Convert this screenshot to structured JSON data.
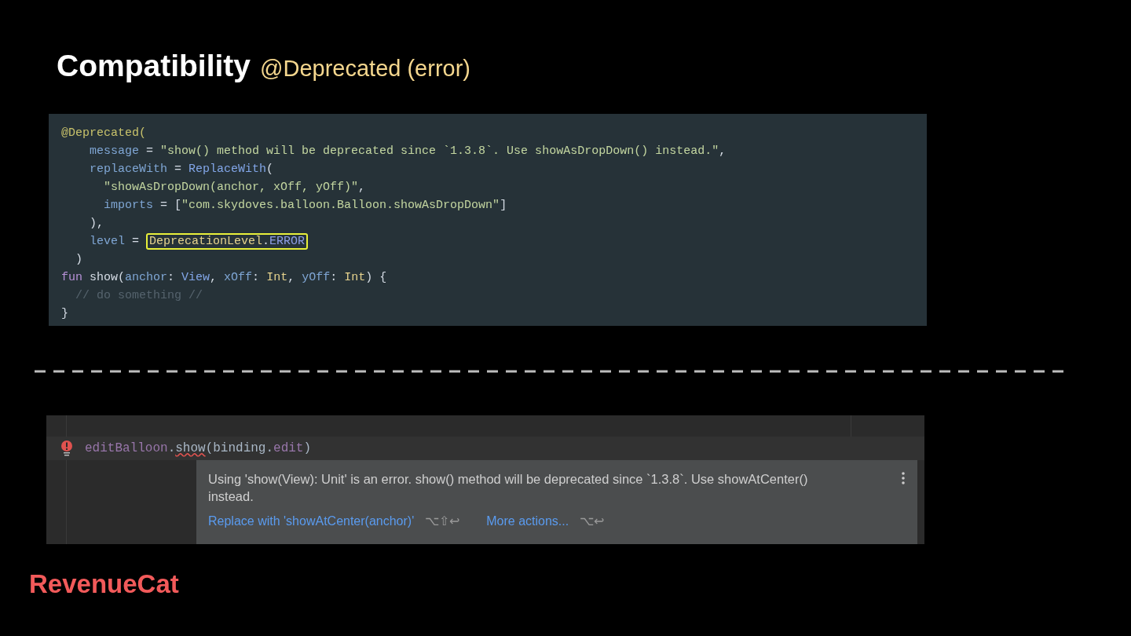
{
  "title": {
    "main": "Compatibility",
    "subtitle": "@Deprecated (error)"
  },
  "declaration_code": [
    [
      {
        "kind": "annotation",
        "text": "@Deprecated("
      }
    ],
    [
      {
        "kind": "param",
        "text": "    message"
      },
      {
        "kind": "plain",
        "text": " = "
      },
      {
        "kind": "string",
        "text": "\"show() method will be deprecated since `1.3.8`. Use showAsDropDown() instead.\""
      },
      {
        "kind": "plain",
        "text": ","
      }
    ],
    [
      {
        "kind": "param",
        "text": "    replaceWith"
      },
      {
        "kind": "plain",
        "text": " = "
      },
      {
        "kind": "type",
        "text": "ReplaceWith"
      },
      {
        "kind": "plain",
        "text": "("
      }
    ],
    [
      {
        "kind": "string",
        "text": "      \"showAsDropDown(anchor, xOff, yOff)\""
      },
      {
        "kind": "plain",
        "text": ","
      }
    ],
    [
      {
        "kind": "param",
        "text": "      imports"
      },
      {
        "kind": "plain",
        "text": " = ["
      },
      {
        "kind": "string",
        "text": "\"com.skydoves.balloon.Balloon.showAsDropDown\""
      },
      {
        "kind": "plain",
        "text": "]"
      }
    ],
    [
      {
        "kind": "plain",
        "text": "    ),"
      }
    ],
    [
      {
        "kind": "param",
        "text": "    level"
      },
      {
        "kind": "plain",
        "text": " = "
      },
      {
        "kind": "highlight",
        "children": [
          {
            "kind": "class",
            "text": "DeprecationLevel"
          },
          {
            "kind": "plain",
            "text": "."
          },
          {
            "kind": "enum",
            "text": "ERROR"
          }
        ]
      }
    ],
    [
      {
        "kind": "plain",
        "text": "  )"
      }
    ],
    [
      {
        "kind": "keyword",
        "text": "fun"
      },
      {
        "kind": "plain",
        "text": " show("
      },
      {
        "kind": "param",
        "text": "anchor"
      },
      {
        "kind": "plain",
        "text": ": "
      },
      {
        "kind": "type",
        "text": "View"
      },
      {
        "kind": "plain",
        "text": ", "
      },
      {
        "kind": "param",
        "text": "xOff"
      },
      {
        "kind": "plain",
        "text": ": "
      },
      {
        "kind": "class",
        "text": "Int"
      },
      {
        "kind": "plain",
        "text": ", "
      },
      {
        "kind": "param",
        "text": "yOff"
      },
      {
        "kind": "plain",
        "text": ": "
      },
      {
        "kind": "class",
        "text": "Int"
      },
      {
        "kind": "plain",
        "text": ") {"
      }
    ],
    [
      {
        "kind": "comment",
        "text": "  // do something //"
      }
    ],
    [
      {
        "kind": "plain",
        "text": "}"
      }
    ]
  ],
  "editor": {
    "code_line": [
      {
        "kind": "field",
        "text": "editBalloon"
      },
      {
        "kind": "plain",
        "text": "."
      },
      {
        "kind": "error",
        "text": "show"
      },
      {
        "kind": "plain",
        "text": "(binding."
      },
      {
        "kind": "field",
        "text": "edit"
      },
      {
        "kind": "plain",
        "text": ")"
      }
    ],
    "popup": {
      "message": "Using 'show(View): Unit' is an error. show() method will be deprecated since `1.3.8`. Use showAtCenter() instead.",
      "actions": [
        {
          "label": "Replace with 'showAtCenter(anchor)'",
          "shortcut": "⌥⇧↩"
        },
        {
          "label": "More actions...",
          "shortcut": "⌥↩"
        }
      ]
    }
  },
  "logo": "RevenueCat"
}
